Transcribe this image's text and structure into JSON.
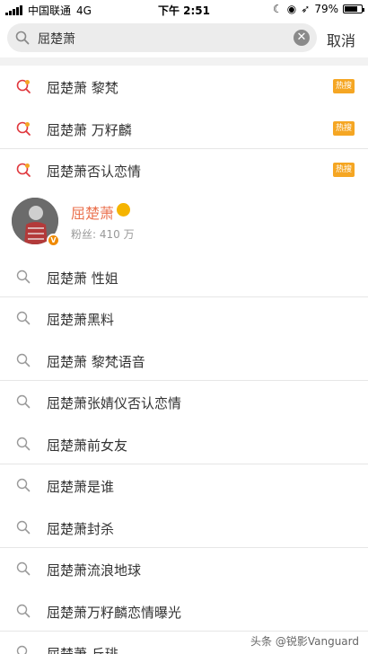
{
  "status_bar": {
    "carrier": "中国联通",
    "network": "4G",
    "time": "下午 2:51",
    "battery": "79%",
    "battery_level": 0.79
  },
  "search": {
    "query": "屈楚萧",
    "clear_icon": "close-circle-icon",
    "cancel_label": "取消"
  },
  "hot_suggestions": [
    {
      "text": "屈楚萧 黎梵",
      "badge": "热搜"
    },
    {
      "text": "屈楚萧 万籽麟",
      "badge": "热搜"
    },
    {
      "text": "屈楚萧否认恋情",
      "badge": "热搜"
    }
  ],
  "user_card": {
    "name": "屈楚萧",
    "fans": "粉丝: 410 万",
    "verified_badge": "V",
    "accent_color": "#eb7350"
  },
  "suggestions": [
    "屈楚萧 性姐",
    "屈楚萧黑料",
    "屈楚萧 黎梵语音",
    "屈楚萧张婧仪否认恋情",
    "屈楚萧前女友",
    "屈楚萧是谁",
    "屈楚萧封杀",
    "屈楚萧流浪地球",
    "屈楚萧万籽麟恋情曝光",
    "屈楚萧 丘琲"
  ],
  "watermark": "头条 @锐影Vanguard"
}
